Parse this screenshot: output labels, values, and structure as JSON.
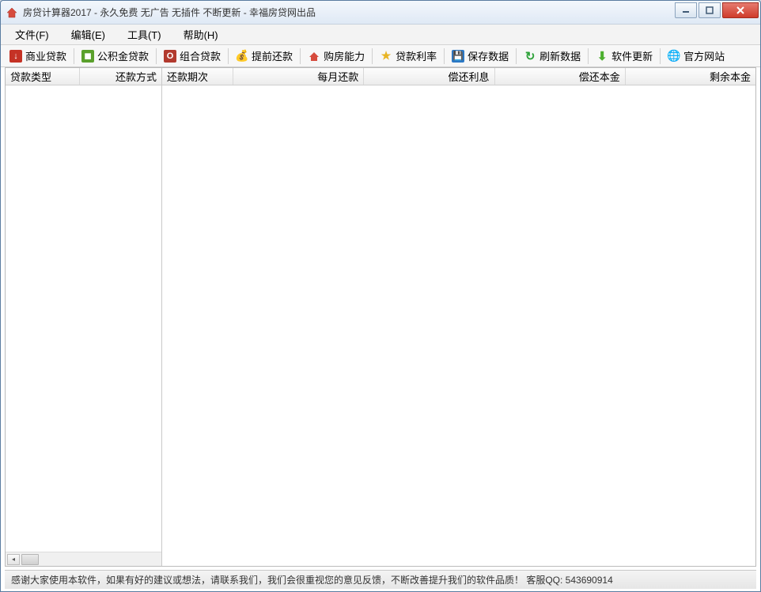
{
  "window": {
    "title": "房贷计算器2017 - 永久免费 无广告 无插件 不断更新 - 幸福房贷网出品"
  },
  "menu": {
    "file": "文件(F)",
    "edit": "编辑(E)",
    "tool": "工具(T)",
    "help": "帮助(H)"
  },
  "toolbar": {
    "commercial": "商业贷款",
    "fund": "公积金贷款",
    "combo": "组合贷款",
    "prepay": "提前还款",
    "ability": "购房能力",
    "rate": "贷款利率",
    "save": "保存数据",
    "refresh": "刷新数据",
    "update": "软件更新",
    "website": "官方网站"
  },
  "left_cols": {
    "type": "贷款类型",
    "method": "还款方式"
  },
  "right_cols": {
    "period": "还款期次",
    "monthly": "每月还款",
    "interest": "偿还利息",
    "principal": "偿还本金",
    "remain": "剩余本金"
  },
  "statusbar": {
    "text": "感谢大家使用本软件，如果有好的建议或想法，请联系我们，我们会很重视您的意见反馈，不断改善提升我们的软件品质！ 客服QQ: 543690914"
  }
}
